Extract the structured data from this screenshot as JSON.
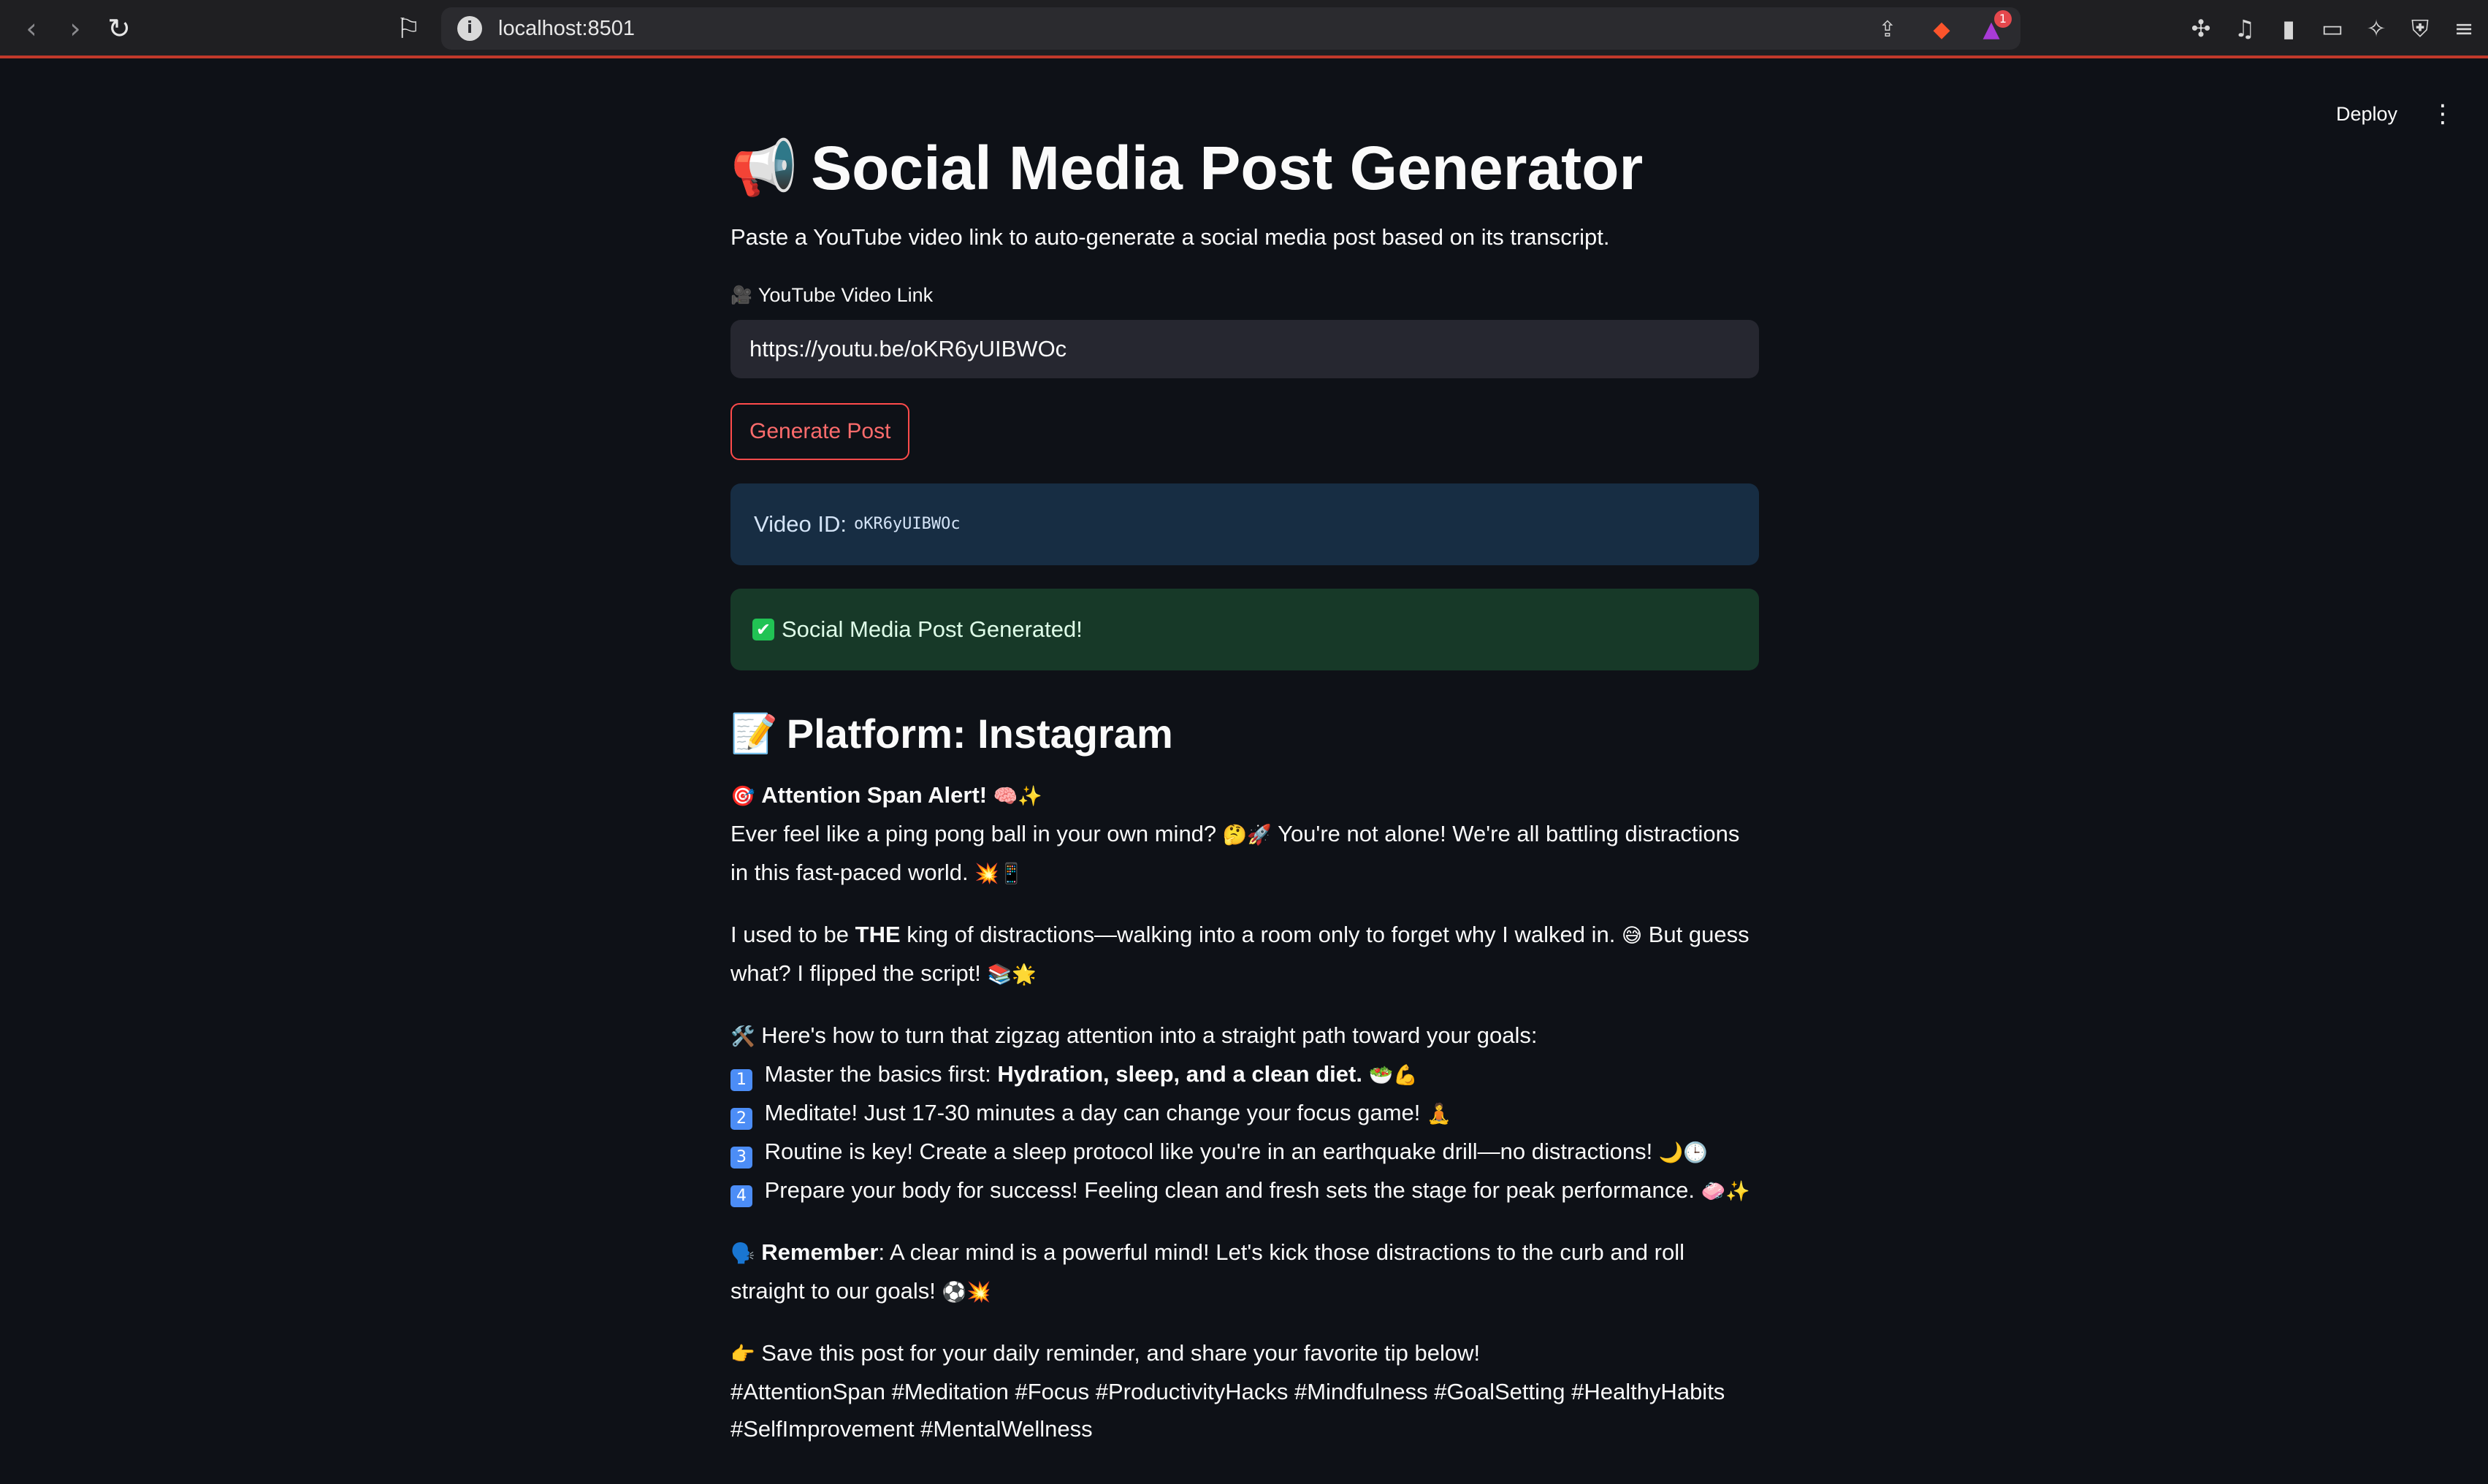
{
  "browser": {
    "url": "localhost:8501",
    "back_icon": "‹",
    "forward_icon": "›",
    "reload_icon": "↻",
    "bookmark_icon": "⚐",
    "info_icon": "i",
    "share_icon": "⇪",
    "brave_icon": "◆",
    "rewards_icon": "▲",
    "rewards_badge": "1",
    "extensions_icon": "✣",
    "media_icon": "♫",
    "sidebar_icon": "▮",
    "wallet_icon": "▭",
    "leo_icon": "✧",
    "vpn_icon": "⛨",
    "menu_icon": "≡"
  },
  "app": {
    "deploy_label": "Deploy",
    "menu_icon": "⋮",
    "title_emoji": "📢",
    "title": "Social Media Post Generator",
    "subtitle": "Paste a YouTube video link to auto-generate a social media post based on its transcript.",
    "input_label_emoji": "🎥",
    "input_label": "YouTube Video Link",
    "input_value": "https://youtu.be/oKR6yUIBWOc",
    "generate_button": "Generate Post",
    "video_id_label": "Video ID:",
    "video_id": "oKR6yUIBWOc",
    "success_icon": "✔",
    "success_message": "Social Media Post Generated!",
    "platform_emoji": "📝",
    "platform_heading": "Platform: Instagram"
  },
  "post": {
    "p1": {
      "e1": "🎯",
      "bold": "Attention Span Alert!",
      "e2": "🧠✨",
      "line2": "Ever feel like a ping pong ball in your own mind?",
      "e3": "🤔🚀",
      "line2b": "You're not alone! We're all battling distractions in this fast-paced world.",
      "e4": "💥📱"
    },
    "p2": {
      "pre": "I used to be",
      "bold": "THE",
      "post": "king of distractions—walking into a room only to forget why I walked in.",
      "e1": "😅",
      "post2": "But guess what? I flipped the script!",
      "e2": "📚🌟"
    },
    "p3": {
      "e0": "🛠️",
      "intro": "Here's how to turn that zigzag attention into a straight path toward your goals:",
      "n1": "1",
      "t1": "Master the basics first:",
      "t1b": "Hydration, sleep, and a clean diet.",
      "e1": "🥗💪",
      "n2": "2",
      "t2": "Meditate! Just 17-30 minutes a day can change your focus game!",
      "e2": "🧘",
      "n3": "3",
      "t3": "Routine is key! Create a sleep protocol like you're in an earthquake drill—no distractions!",
      "e3": "🌙🕒",
      "n4": "4",
      "t4": "Prepare your body for success! Feeling clean and fresh sets the stage for peak performance.",
      "e4": "🧼✨"
    },
    "p4": {
      "e0": "🗣️",
      "bold": "Remember",
      "text": ": A clear mind is a powerful mind! Let's kick those distractions to the curb and roll straight to our goals!",
      "e1": "⚽💥"
    },
    "p5": {
      "e0": "👉",
      "text": "Save this post for your daily reminder, and share your favorite tip below!",
      "hashtags": "#AttentionSpan #Meditation #Focus #ProductivityHacks #Mindfulness #GoalSetting #HealthyHabits #SelfImprovement #MentalWellness"
    }
  }
}
